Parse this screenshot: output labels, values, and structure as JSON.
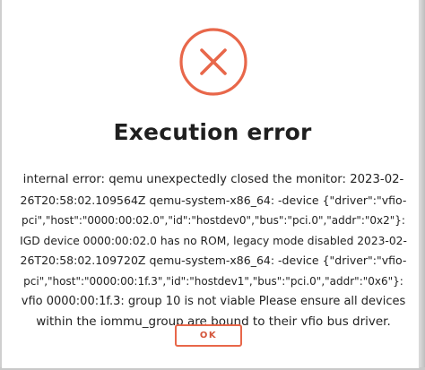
{
  "dialog": {
    "title": "Execution error",
    "icon": "error-x-circle-icon",
    "accent_color": "#e8674a",
    "message_lines": [
      "internal error: qemu unexpectedly closed the monitor: 2023-02-",
      "26T20:58:02.109564Z qemu-system-x86_64: -device {\"driver\":\"vfio-",
      "pci\",\"host\":\"0000:00:02.0\",\"id\":\"hostdev0\",\"bus\":\"pci.0\",\"addr\":\"0x2\"}:",
      "IGD device 0000:00:02.0 has no ROM, legacy mode disabled 2023-02-",
      "26T20:58:02.109720Z qemu-system-x86_64: -device {\"driver\":\"vfio-",
      "pci\",\"host\":\"0000:00:1f.3\",\"id\":\"hostdev1\",\"bus\":\"pci.0\",\"addr\":\"0x6\"}:",
      "vfio 0000:00:1f.3: group 10 is not viable Please ensure all devices",
      "within the iommu_group are bound to their vfio bus driver."
    ],
    "ok_label": "OK"
  }
}
